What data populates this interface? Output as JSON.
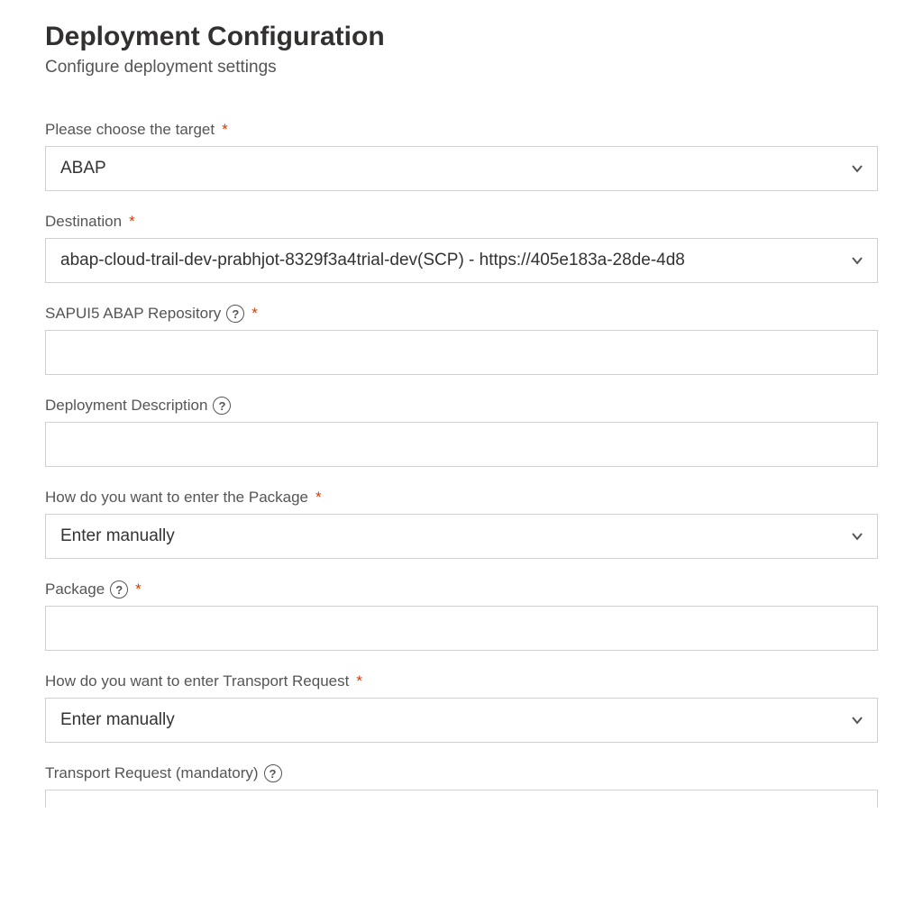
{
  "header": {
    "title": "Deployment Configuration",
    "subtitle": "Configure deployment settings"
  },
  "requiredMark": "*",
  "helpGlyph": "?",
  "fields": {
    "target": {
      "label": "Please choose the target",
      "value": "ABAP"
    },
    "destination": {
      "label": "Destination",
      "value": "abap-cloud-trail-dev-prabhjot-8329f3a4trial-dev(SCP) - https://405e183a-28de-4d8"
    },
    "repository": {
      "label": "SAPUI5 ABAP Repository",
      "value": ""
    },
    "description": {
      "label": "Deployment Description",
      "value": ""
    },
    "packageMode": {
      "label": "How do you want to enter the Package",
      "value": "Enter manually"
    },
    "package": {
      "label": "Package",
      "value": ""
    },
    "transportMode": {
      "label": "How do you want to enter Transport Request",
      "value": "Enter manually"
    },
    "transport": {
      "label": "Transport Request (mandatory)",
      "value": ""
    }
  }
}
